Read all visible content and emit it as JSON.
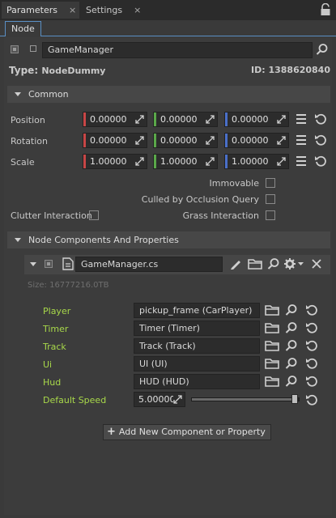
{
  "tabs": [
    {
      "label": "Parameters",
      "close": "×"
    },
    {
      "label": "Settings",
      "close": "×"
    }
  ],
  "subtab": "Node",
  "node": {
    "name": "GameManager",
    "type_label": "Type:",
    "type_value": "NodeDummy",
    "id_label": "ID:",
    "id_value": "1388620840"
  },
  "common": {
    "title": "Common",
    "position_label": "Position",
    "rotation_label": "Rotation",
    "scale_label": "Scale",
    "position": [
      "0.00000",
      "0.00000",
      "0.00000"
    ],
    "rotation": [
      "0.00000",
      "0.00000",
      "0.00000"
    ],
    "scale": [
      "1.00000",
      "1.00000",
      "1.00000"
    ],
    "immovable": "Immovable",
    "culled": "Culled by Occlusion Query",
    "clutter": "Clutter Interaction",
    "grass": "Grass Interaction"
  },
  "components": {
    "title": "Node Components And Properties",
    "file": "GameManager.cs",
    "size": "Size: 16777216.0TB",
    "props": [
      {
        "label": "Player",
        "value": "pickup_frame (CarPlayer)"
      },
      {
        "label": "Timer",
        "value": "Timer (Timer)"
      },
      {
        "label": "Track",
        "value": "Track (Track)"
      },
      {
        "label": "Ui",
        "value": "UI (UI)"
      },
      {
        "label": "Hud",
        "value": "HUD (HUD)"
      }
    ],
    "speed_label": "Default Speed",
    "speed_value": "5.00000",
    "speed_slider": 0.98,
    "add_button": "Add New Component or Property"
  },
  "colors": {
    "x_axis": "#c84646",
    "y_axis": "#5aa84a",
    "z_axis": "#4a6fc8",
    "property_label": "#a8d84a"
  }
}
